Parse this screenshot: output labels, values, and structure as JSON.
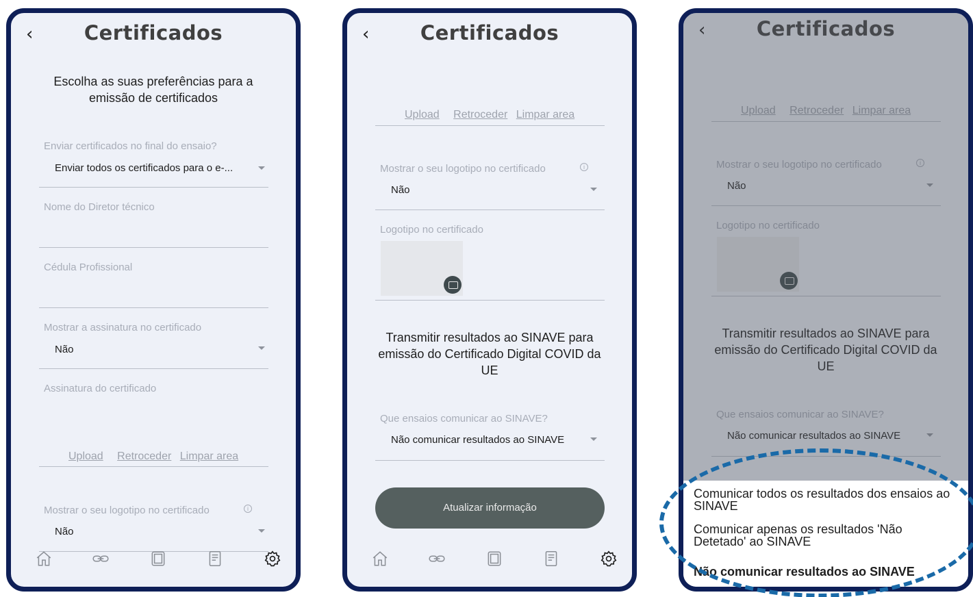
{
  "screens": [
    {
      "back": "‹",
      "title": "Certificados",
      "intro": "Escolha as suas preferências para a emissão de certificados",
      "send_label": "Enviar certificados no final do ensaio?",
      "send_value": "Enviar todos os certificados para o e-...",
      "director_label": "Nome do Diretor técnico",
      "cedula_label": "Cédula Profissional",
      "sign_label": "Mostrar a assinatura no certificado",
      "sign_value": "Não",
      "signature_label": "Assinatura do certificado",
      "links": {
        "upload": "Upload",
        "back": "Retroceder",
        "clear": "Limpar area"
      },
      "logo_label": "Mostrar o seu logotipo no certificado",
      "logo_value": "Não"
    },
    {
      "back": "‹",
      "title": "Certificados",
      "links": {
        "upload": "Upload",
        "back": "Retroceder",
        "clear": "Limpar area"
      },
      "logo_label": "Mostrar o seu logotipo no certificado",
      "logo_value": "Não",
      "logo_field_label": "Logotipo no certificado",
      "sinave_text": "Transmitir resultados ao SINAVE para emissão do Certificado Digital COVID da UE",
      "sinave_label": "Que ensaios comunicar ao SINAVE?",
      "sinave_value": "Não comunicar resultados ao SINAVE",
      "update_button": "Atualizar informação"
    },
    {
      "back": "‹",
      "title": "Certificados",
      "links": {
        "upload": "Upload",
        "back": "Retroceder",
        "clear": "Limpar area"
      },
      "logo_label": "Mostrar o seu logotipo no certificado",
      "logo_value": "Não",
      "logo_field_label": "Logotipo no certificado",
      "sinave_text": "Transmitir resultados ao SINAVE para emissão do Certificado Digital COVID da UE",
      "sinave_label": "Que ensaios comunicar ao SINAVE?",
      "sinave_value": "Não comunicar resultados ao SINAVE",
      "options": [
        "Comunicar todos os resultados dos ensaios ao SINAVE",
        "Comunicar apenas os resultados 'Não Detetado' ao SINAVE",
        "Não comunicar resultados ao SINAVE"
      ],
      "selected_option": "Não comunicar resultados ao SINAVE"
    }
  ],
  "nav_icons": [
    "home-icon",
    "link-icon",
    "tablet-icon",
    "document-icon",
    "settings-icon"
  ],
  "colors": {
    "frame": "#0e1f57",
    "screen_bg": "#eef1f8",
    "button": "#55605f",
    "highlight": "#1a6aa8"
  }
}
